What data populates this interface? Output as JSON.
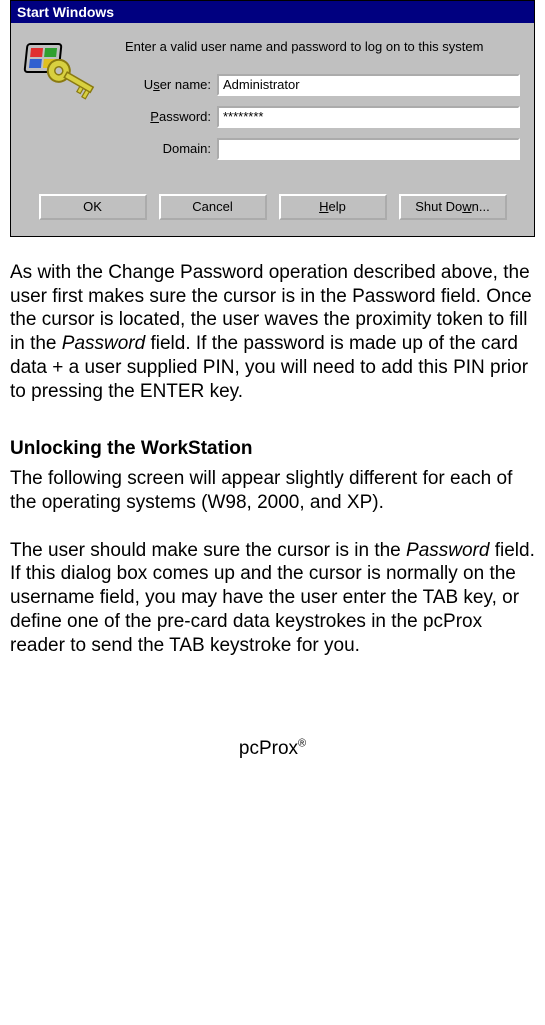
{
  "dialog": {
    "title": "Start Windows",
    "instruction": "Enter a valid user name and password to log on to this system",
    "fields": {
      "username_label_pre": "U",
      "username_label_ul": "s",
      "username_label_post": "er name:",
      "username_value": "Administrator",
      "password_label_pre": "",
      "password_label_ul": "P",
      "password_label_post": "assword:",
      "password_value": "********",
      "domain_label": "Domain:",
      "domain_value": ""
    },
    "buttons": {
      "ok": "OK",
      "cancel": "Cancel",
      "help_pre": "",
      "help_ul": "H",
      "help_post": "elp",
      "shutdown_pre": "Shut Do",
      "shutdown_ul": "w",
      "shutdown_post": "n..."
    }
  },
  "doc": {
    "p1a": "As with the Change Password operation described above, the user first makes sure the cursor is in the Password field.  Once the cursor is located, the user waves the proximity token to fill in the ",
    "p1_em": "Password",
    "p1b": " field. If the password is made up of the card data + a user supplied PIN, you will need to add this PIN prior to pressing the ENTER key.",
    "heading": "Unlocking the WorkStation",
    "p2": "The following screen will appear slightly different for each of the operating systems (W98, 2000, and XP).",
    "p3a": "The user should make sure the cursor is in the ",
    "p3_em": "Password",
    "p3b": " field.  If this dialog box comes up and the cursor is normally on the username field, you may have the user enter the TAB key, or define one of the pre-card data keystrokes in the pcProx reader to send the TAB keystroke for you.",
    "footer_name": "pcProx",
    "footer_sym": "®"
  }
}
